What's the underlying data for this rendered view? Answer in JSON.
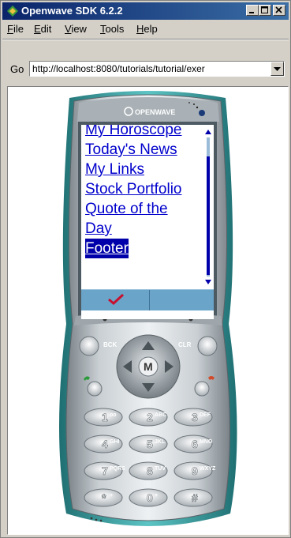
{
  "window": {
    "title": "Openwave SDK 6.2.2"
  },
  "menu": {
    "items": [
      {
        "label": "File",
        "mnemonic": "F",
        "rest": "ile"
      },
      {
        "label": "Edit",
        "mnemonic": "E",
        "rest": "dit"
      },
      {
        "label": "View",
        "mnemonic": "V",
        "rest": "iew"
      },
      {
        "label": "Tools",
        "mnemonic": "T",
        "rest": "ools"
      },
      {
        "label": "Help",
        "mnemonic": "H",
        "rest": "elp"
      }
    ]
  },
  "address": {
    "go_label": "Go",
    "url": "http://localhost:8080/tutorials/tutorial/exer"
  },
  "phone": {
    "brand": "OPENWAVE",
    "screen_items": [
      {
        "label": "My Horoscope"
      },
      {
        "label": "Today's News"
      },
      {
        "label": "My Links"
      },
      {
        "label": "Stock Portfolio"
      },
      {
        "label": "Quote of the"
      },
      {
        "label": "Day"
      },
      {
        "label": "Footer"
      }
    ],
    "selected_item": "Footer",
    "keys": {
      "back": "BCK",
      "clear": "CLR",
      "menu": "M",
      "k1": {
        "num": "1",
        "sub": "oo"
      },
      "k2": {
        "num": "2",
        "sub": "ABC"
      },
      "k3": {
        "num": "3",
        "sub": "DEF"
      },
      "k4": {
        "num": "4",
        "sub": "GHI"
      },
      "k5": {
        "num": "5",
        "sub": "JKL"
      },
      "k6": {
        "num": "6",
        "sub": "MNO"
      },
      "k7": {
        "num": "7",
        "sub": "PQRS"
      },
      "k8": {
        "num": "8",
        "sub": "TUV"
      },
      "k9": {
        "num": "9",
        "sub": "WXYZ"
      },
      "kstar": {
        "num": "*",
        "sub": "+"
      },
      "k0": {
        "num": "0",
        "sub": "+"
      },
      "khash": {
        "num": "#",
        "sub": ""
      }
    }
  },
  "colors": {
    "title_bar": "#0a246a",
    "link": "#0000cc",
    "selection": "#0000aa",
    "softkey_bar": "#6aa4c8",
    "phone_accent": "#3fa8a8"
  }
}
